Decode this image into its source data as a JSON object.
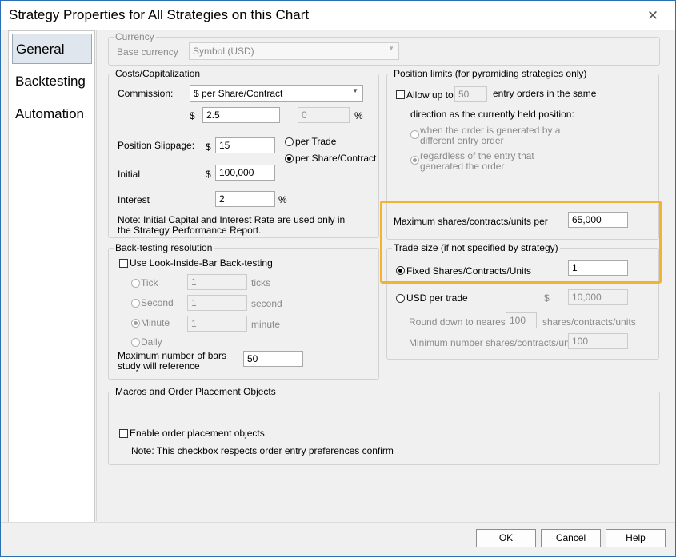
{
  "window": {
    "title": "Strategy Properties for All Strategies on this Chart",
    "close_glyph": "✕"
  },
  "nav": {
    "items": [
      {
        "label": "General"
      },
      {
        "label": "Backtesting"
      },
      {
        "label": "Automation"
      }
    ]
  },
  "currency": {
    "group_label": "Currency",
    "base_label": "Base currency",
    "base_value": "Symbol (USD)"
  },
  "costs": {
    "group_label": "Costs/Capitalization",
    "commission_label": "Commission:",
    "commission_value": "$ per Share/Contract",
    "dollar": "$",
    "commission_amount": "2.5",
    "commission_pct": "0",
    "pct": "%",
    "slippage_label": "Position Slippage:",
    "slippage_value": "15",
    "per_trade_label": "per Trade",
    "per_share_label": "per Share/Contract",
    "initial_label": "Initial",
    "initial_value": "100,000",
    "interest_label": "Interest",
    "interest_value": "2",
    "note_line1": "Note: Initial Capital and Interest Rate are used only in",
    "note_line2": "the Strategy Performance Report."
  },
  "backtest": {
    "group_label": "Back-testing resolution",
    "lib_label": "Use Look-Inside-Bar Back-testing",
    "tick_label": "Tick",
    "tick_value": "1",
    "tick_unit": "ticks",
    "second_label": "Second",
    "second_value": "1",
    "second_unit": "second",
    "minute_label": "Minute",
    "minute_value": "1",
    "minute_unit": "minute",
    "daily_label": "Daily",
    "maxbars_line1": "Maximum number of bars",
    "maxbars_line2": "study will reference",
    "maxbars_value": "50"
  },
  "position": {
    "group_label": "Position limits (for pyramiding strategies only)",
    "allow_label": "Allow up to",
    "allow_value": "50",
    "entry_label": "entry orders in the same",
    "direction_label": "direction as the currently held position:",
    "opt1_line1": "when the order is generated by a",
    "opt1_line2": "different entry order",
    "opt2_line1": "regardless of the entry that",
    "opt2_line2": "generated the order"
  },
  "maxshares": {
    "label": "Maximum shares/contracts/units per",
    "value": "65,000"
  },
  "tradesize": {
    "group_label": "Trade size (if not specified by strategy)",
    "fixed_label": "Fixed Shares/Contracts/Units",
    "fixed_value": "1",
    "usd_label": "USD per trade",
    "dollar": "$",
    "usd_value": "10,000",
    "round_label": "Round down to nearest",
    "round_value": "100",
    "round_unit": "shares/contracts/units",
    "min_label": "Minimum number shares/contracts/units:",
    "min_value": "100"
  },
  "macros": {
    "group_label": "Macros and Order Placement Objects",
    "enable_label": "Enable order placement objects",
    "note": "Note: This checkbox respects order entry preferences confirm"
  },
  "buttons": {
    "ok": "OK",
    "cancel": "Cancel",
    "help": "Help"
  },
  "colors": {
    "highlight": "#f2b333",
    "window_border": "#2b6fb0"
  }
}
